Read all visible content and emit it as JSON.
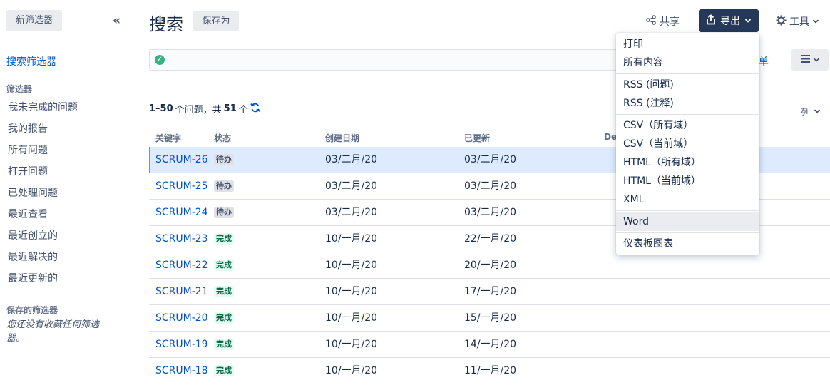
{
  "sidebar": {
    "new_filter": "新筛选器",
    "collapse": "«",
    "search_filters": "搜索筛选器",
    "filters_heading": "筛选器",
    "filters": [
      "我未完成的问题",
      "我的报告",
      "所有问题",
      "打开问题",
      "已处理问题",
      "最近查看",
      "最近创立的",
      "最近解决的",
      "最近更新的"
    ],
    "saved_heading": "保存的筛选器",
    "saved_empty": "您还没有收藏任何筛选器。"
  },
  "header": {
    "title": "搜索",
    "save_as": "保存为",
    "share": "共享",
    "export": "导出",
    "tools": "工具"
  },
  "toolbar": {
    "list_label": "单"
  },
  "results": {
    "range": "1–50",
    "mid": " 个问题，共 ",
    "total": "51",
    "suffix": " 个",
    "columns_btn": "列"
  },
  "table": {
    "headers": {
      "key": "关键字",
      "status": "状态",
      "created": "创建日期",
      "updated": "已更新",
      "dev": "Dev"
    },
    "rows": [
      {
        "key": "SCRUM-26",
        "status": "待办",
        "status_type": "todo",
        "created": "03/二月/20",
        "updated": "03/二月/20"
      },
      {
        "key": "SCRUM-25",
        "status": "待办",
        "status_type": "todo",
        "created": "03/二月/20",
        "updated": "03/二月/20"
      },
      {
        "key": "SCRUM-24",
        "status": "待办",
        "status_type": "todo",
        "created": "03/二月/20",
        "updated": "03/二月/20"
      },
      {
        "key": "SCRUM-23",
        "status": "完成",
        "status_type": "done",
        "created": "10/一月/20",
        "updated": "22/一月/20"
      },
      {
        "key": "SCRUM-22",
        "status": "完成",
        "status_type": "done",
        "created": "10/一月/20",
        "updated": "20/一月/20"
      },
      {
        "key": "SCRUM-21",
        "status": "完成",
        "status_type": "done",
        "created": "10/一月/20",
        "updated": "17/一月/20"
      },
      {
        "key": "SCRUM-20",
        "status": "完成",
        "status_type": "done",
        "created": "10/一月/20",
        "updated": "15/一月/20"
      },
      {
        "key": "SCRUM-19",
        "status": "完成",
        "status_type": "done",
        "created": "10/一月/20",
        "updated": "14/一月/20"
      },
      {
        "key": "SCRUM-18",
        "status": "完成",
        "status_type": "done",
        "created": "10/一月/20",
        "updated": "11/一月/20"
      }
    ]
  },
  "export_menu": {
    "items": [
      "打印",
      "所有内容",
      "RSS (问题)",
      "RSS (注释)",
      "CSV（所有域）",
      "CSV（当前域）",
      "HTML（所有域）",
      "HTML（当前域）",
      "XML",
      "Word",
      "仪表板图表"
    ],
    "hovered": "Word"
  },
  "colors": {
    "link": "#0052cc",
    "export_bg": "#253858",
    "selected_row": "#deebff",
    "done_badge": "#e3fcef",
    "todo_badge": "#dfe1e6",
    "success": "#36b37e"
  }
}
